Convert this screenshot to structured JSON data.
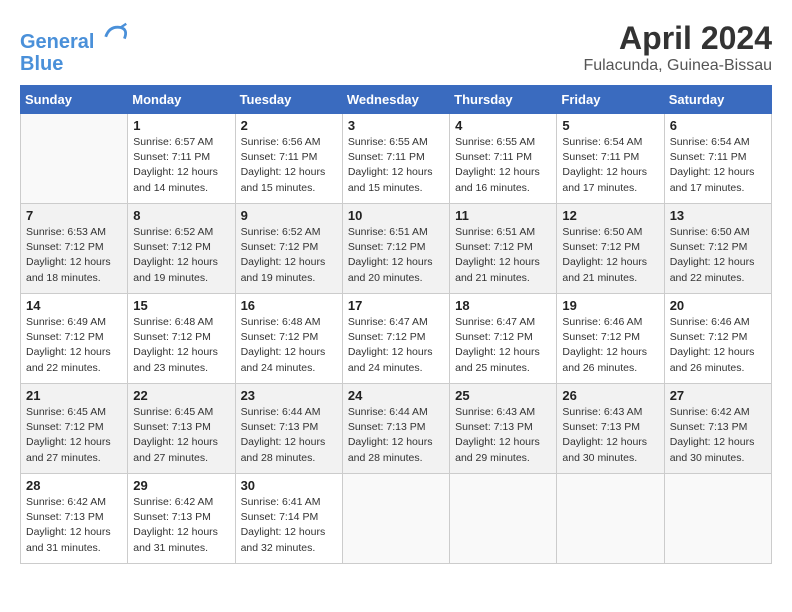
{
  "header": {
    "logo_line1": "General",
    "logo_line2": "Blue",
    "month": "April 2024",
    "location": "Fulacunda, Guinea-Bissau"
  },
  "columns": [
    "Sunday",
    "Monday",
    "Tuesday",
    "Wednesday",
    "Thursday",
    "Friday",
    "Saturday"
  ],
  "weeks": [
    [
      {
        "day": null
      },
      {
        "day": "1",
        "sunrise": "6:57 AM",
        "sunset": "7:11 PM",
        "daylight": "12 hours and 14 minutes."
      },
      {
        "day": "2",
        "sunrise": "6:56 AM",
        "sunset": "7:11 PM",
        "daylight": "12 hours and 15 minutes."
      },
      {
        "day": "3",
        "sunrise": "6:55 AM",
        "sunset": "7:11 PM",
        "daylight": "12 hours and 15 minutes."
      },
      {
        "day": "4",
        "sunrise": "6:55 AM",
        "sunset": "7:11 PM",
        "daylight": "12 hours and 16 minutes."
      },
      {
        "day": "5",
        "sunrise": "6:54 AM",
        "sunset": "7:11 PM",
        "daylight": "12 hours and 17 minutes."
      },
      {
        "day": "6",
        "sunrise": "6:54 AM",
        "sunset": "7:11 PM",
        "daylight": "12 hours and 17 minutes."
      }
    ],
    [
      {
        "day": "7",
        "sunrise": "6:53 AM",
        "sunset": "7:12 PM",
        "daylight": "12 hours and 18 minutes."
      },
      {
        "day": "8",
        "sunrise": "6:52 AM",
        "sunset": "7:12 PM",
        "daylight": "12 hours and 19 minutes."
      },
      {
        "day": "9",
        "sunrise": "6:52 AM",
        "sunset": "7:12 PM",
        "daylight": "12 hours and 19 minutes."
      },
      {
        "day": "10",
        "sunrise": "6:51 AM",
        "sunset": "7:12 PM",
        "daylight": "12 hours and 20 minutes."
      },
      {
        "day": "11",
        "sunrise": "6:51 AM",
        "sunset": "7:12 PM",
        "daylight": "12 hours and 21 minutes."
      },
      {
        "day": "12",
        "sunrise": "6:50 AM",
        "sunset": "7:12 PM",
        "daylight": "12 hours and 21 minutes."
      },
      {
        "day": "13",
        "sunrise": "6:50 AM",
        "sunset": "7:12 PM",
        "daylight": "12 hours and 22 minutes."
      }
    ],
    [
      {
        "day": "14",
        "sunrise": "6:49 AM",
        "sunset": "7:12 PM",
        "daylight": "12 hours and 22 minutes."
      },
      {
        "day": "15",
        "sunrise": "6:48 AM",
        "sunset": "7:12 PM",
        "daylight": "12 hours and 23 minutes."
      },
      {
        "day": "16",
        "sunrise": "6:48 AM",
        "sunset": "7:12 PM",
        "daylight": "12 hours and 24 minutes."
      },
      {
        "day": "17",
        "sunrise": "6:47 AM",
        "sunset": "7:12 PM",
        "daylight": "12 hours and 24 minutes."
      },
      {
        "day": "18",
        "sunrise": "6:47 AM",
        "sunset": "7:12 PM",
        "daylight": "12 hours and 25 minutes."
      },
      {
        "day": "19",
        "sunrise": "6:46 AM",
        "sunset": "7:12 PM",
        "daylight": "12 hours and 26 minutes."
      },
      {
        "day": "20",
        "sunrise": "6:46 AM",
        "sunset": "7:12 PM",
        "daylight": "12 hours and 26 minutes."
      }
    ],
    [
      {
        "day": "21",
        "sunrise": "6:45 AM",
        "sunset": "7:12 PM",
        "daylight": "12 hours and 27 minutes."
      },
      {
        "day": "22",
        "sunrise": "6:45 AM",
        "sunset": "7:13 PM",
        "daylight": "12 hours and 27 minutes."
      },
      {
        "day": "23",
        "sunrise": "6:44 AM",
        "sunset": "7:13 PM",
        "daylight": "12 hours and 28 minutes."
      },
      {
        "day": "24",
        "sunrise": "6:44 AM",
        "sunset": "7:13 PM",
        "daylight": "12 hours and 28 minutes."
      },
      {
        "day": "25",
        "sunrise": "6:43 AM",
        "sunset": "7:13 PM",
        "daylight": "12 hours and 29 minutes."
      },
      {
        "day": "26",
        "sunrise": "6:43 AM",
        "sunset": "7:13 PM",
        "daylight": "12 hours and 30 minutes."
      },
      {
        "day": "27",
        "sunrise": "6:42 AM",
        "sunset": "7:13 PM",
        "daylight": "12 hours and 30 minutes."
      }
    ],
    [
      {
        "day": "28",
        "sunrise": "6:42 AM",
        "sunset": "7:13 PM",
        "daylight": "12 hours and 31 minutes."
      },
      {
        "day": "29",
        "sunrise": "6:42 AM",
        "sunset": "7:13 PM",
        "daylight": "12 hours and 31 minutes."
      },
      {
        "day": "30",
        "sunrise": "6:41 AM",
        "sunset": "7:14 PM",
        "daylight": "12 hours and 32 minutes."
      },
      {
        "day": null
      },
      {
        "day": null
      },
      {
        "day": null
      },
      {
        "day": null
      }
    ]
  ]
}
